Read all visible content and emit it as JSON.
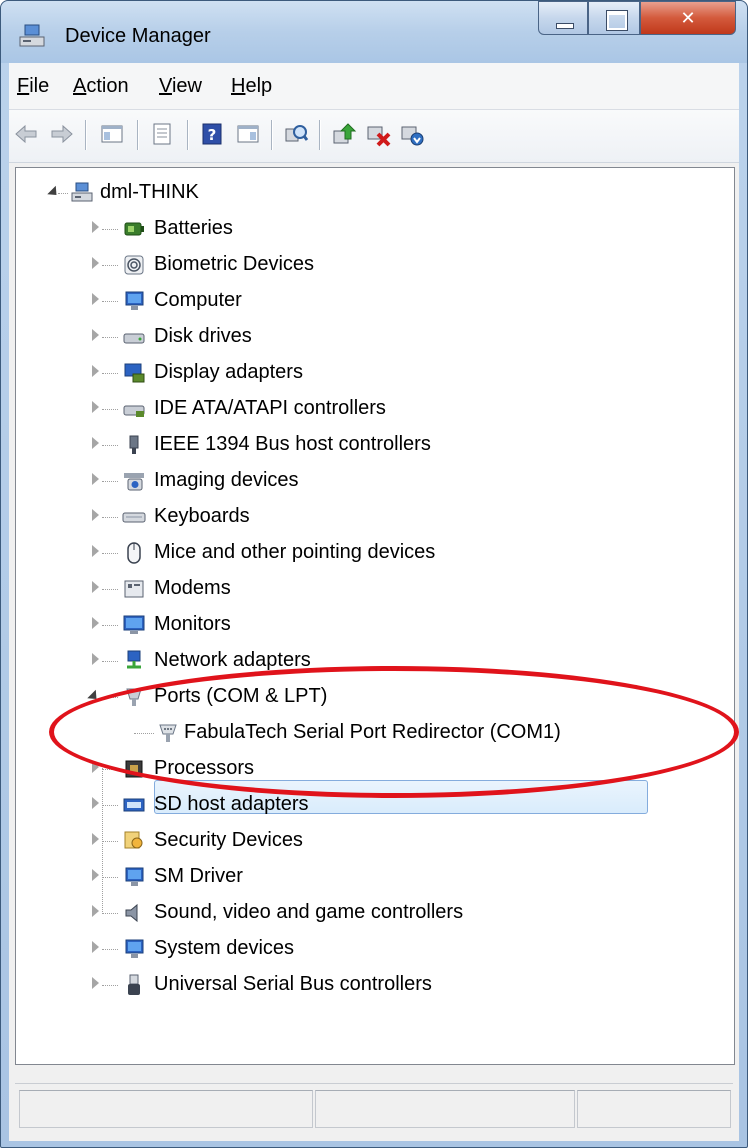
{
  "window": {
    "title": "Device Manager"
  },
  "menu": {
    "file": "File",
    "action": "Action",
    "view": "View",
    "help": "Help"
  },
  "toolbar": {
    "icons": [
      "back-arrow-icon",
      "forward-arrow-icon",
      "show-hide-console-tree-icon",
      "properties-icon",
      "help-icon",
      "show-hide-action-pane-icon",
      "scan-hardware-icon",
      "update-driver-icon",
      "disable-device-icon",
      "uninstall-device-icon"
    ]
  },
  "tree": {
    "root": "dml-THINK",
    "items": [
      {
        "label": "Batteries",
        "icon": "battery-icon"
      },
      {
        "label": "Biometric Devices",
        "icon": "fingerprint-icon"
      },
      {
        "label": "Computer",
        "icon": "computer-icon"
      },
      {
        "label": "Disk drives",
        "icon": "disk-drive-icon"
      },
      {
        "label": "Display adapters",
        "icon": "display-adapter-icon"
      },
      {
        "label": "IDE ATA/ATAPI controllers",
        "icon": "ide-controller-icon"
      },
      {
        "label": "IEEE 1394 Bus host controllers",
        "icon": "firewire-icon"
      },
      {
        "label": "Imaging devices",
        "icon": "camera-icon"
      },
      {
        "label": "Keyboards",
        "icon": "keyboard-icon"
      },
      {
        "label": "Mice and other pointing devices",
        "icon": "mouse-icon"
      },
      {
        "label": "Modems",
        "icon": "modem-icon"
      },
      {
        "label": "Monitors",
        "icon": "monitor-icon"
      },
      {
        "label": "Network adapters",
        "icon": "network-adapter-icon"
      },
      {
        "label": "Ports (COM & LPT)",
        "icon": "port-icon",
        "expanded": true,
        "children": [
          {
            "label": "FabulaTech Serial Port Redirector (COM1)",
            "icon": "serial-port-icon",
            "selected": true
          }
        ]
      },
      {
        "label": "Processors",
        "icon": "processor-icon"
      },
      {
        "label": "SD host adapters",
        "icon": "sd-card-icon"
      },
      {
        "label": "Security Devices",
        "icon": "security-key-icon"
      },
      {
        "label": "SM Driver",
        "icon": "computer-icon"
      },
      {
        "label": "Sound, video and game controllers",
        "icon": "speaker-icon"
      },
      {
        "label": "System devices",
        "icon": "computer-icon"
      },
      {
        "label": "Universal Serial Bus controllers",
        "icon": "usb-icon"
      }
    ]
  },
  "colors": {
    "highlight_ellipse": "#e0131b",
    "selection": "#d9ecfc"
  }
}
